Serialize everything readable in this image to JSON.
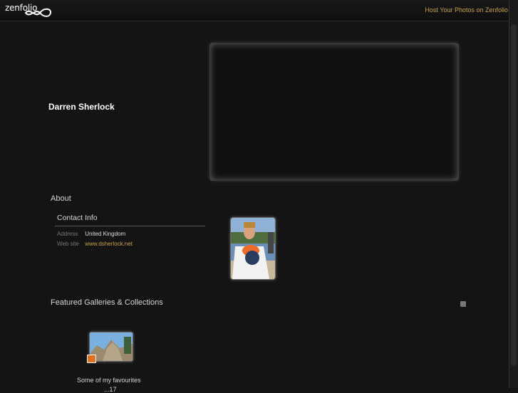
{
  "header": {
    "logo_text": "zenfolio",
    "host_link": "Host Your Photos on Zenfolio"
  },
  "owner": {
    "name": "Darren Sherlock"
  },
  "about": {
    "title": "About",
    "contact_title": "Contact Info",
    "address_label": "Address",
    "address_value": "United Kingdom",
    "website_label": "Web site",
    "website_value": "www.dsherlock.net"
  },
  "featured": {
    "title": "Featured Galleries & Collections",
    "gallery_caption": "Some of my favourites",
    "gallery_caption_line2": "...17"
  },
  "colors": {
    "background": "#141414",
    "link": "#c8a24a"
  },
  "icons": [
    "zenfolio-logo-icon",
    "rss-icon",
    "collection-badge-icon"
  ]
}
